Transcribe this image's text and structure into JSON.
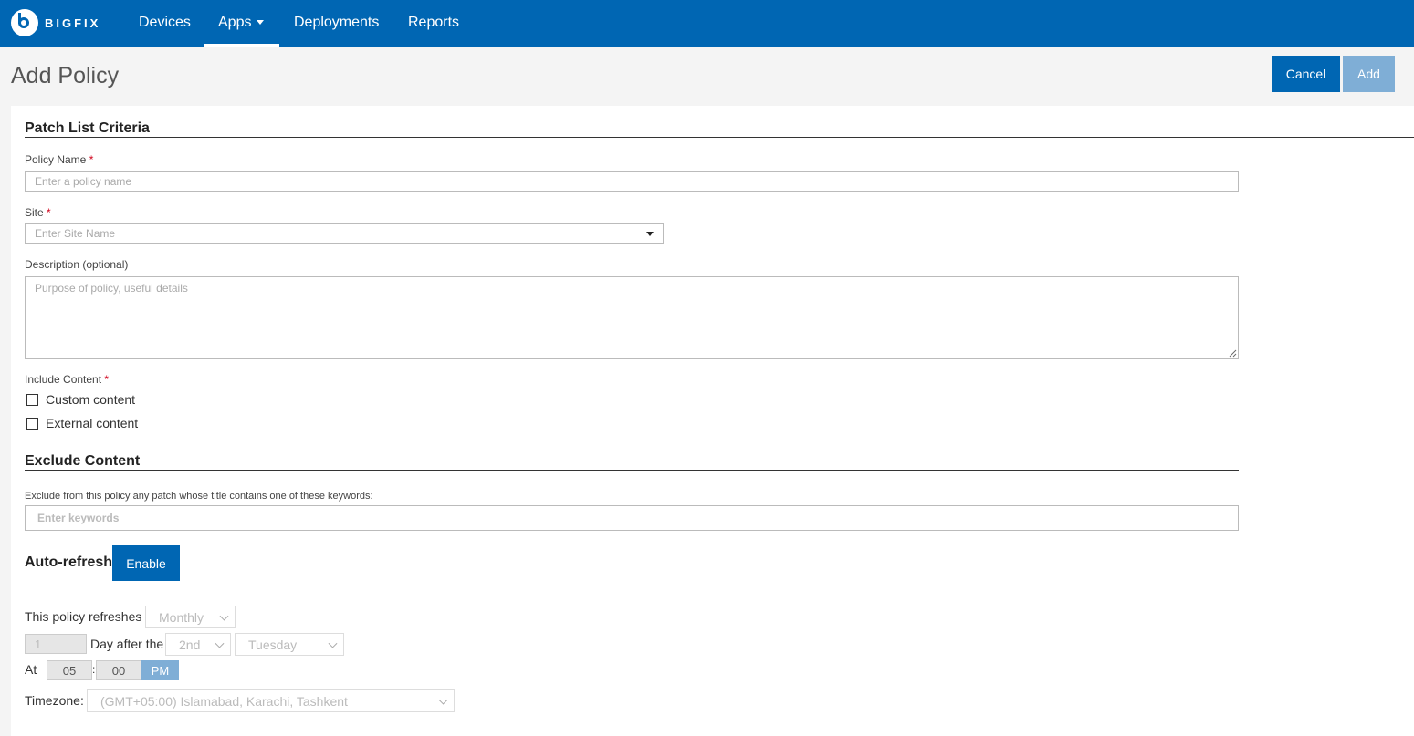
{
  "nav": {
    "brand": "BIGFIX",
    "items": [
      "Devices",
      "Apps",
      "Deployments",
      "Reports"
    ],
    "active": "Apps"
  },
  "header": {
    "title": "Add Policy",
    "cancel_label": "Cancel",
    "add_label": "Add"
  },
  "criteria": {
    "section_title": "Patch List Criteria",
    "policy_name_label": "Policy Name",
    "policy_name_placeholder": "Enter a policy name",
    "site_label": "Site",
    "site_placeholder": "Enter Site Name",
    "description_label": "Description (optional)",
    "description_placeholder": "Purpose of policy, useful details",
    "include_label": "Include Content",
    "include_options": [
      "Custom content",
      "External content"
    ],
    "required_mark": "*"
  },
  "exclude": {
    "section_title": "Exclude Content",
    "hint": "Exclude from this policy any patch whose title contains one of these keywords:",
    "keywords_placeholder": "Enter keywords"
  },
  "auto_refresh": {
    "section_title": "Auto-refresh",
    "enable_label": "Enable",
    "refreshes_label": "This policy refreshes",
    "frequency": "Monthly",
    "day_value": "1",
    "day_after_label": "Day after the",
    "ordinal": "2nd",
    "weekday": "Tuesday",
    "at_label": "At",
    "hour": "05",
    "time_sep": ":",
    "minute": "00",
    "ampm": "PM",
    "timezone_label": "Timezone:",
    "timezone": "(GMT+05:00) Islamabad, Karachi, Tashkent"
  }
}
